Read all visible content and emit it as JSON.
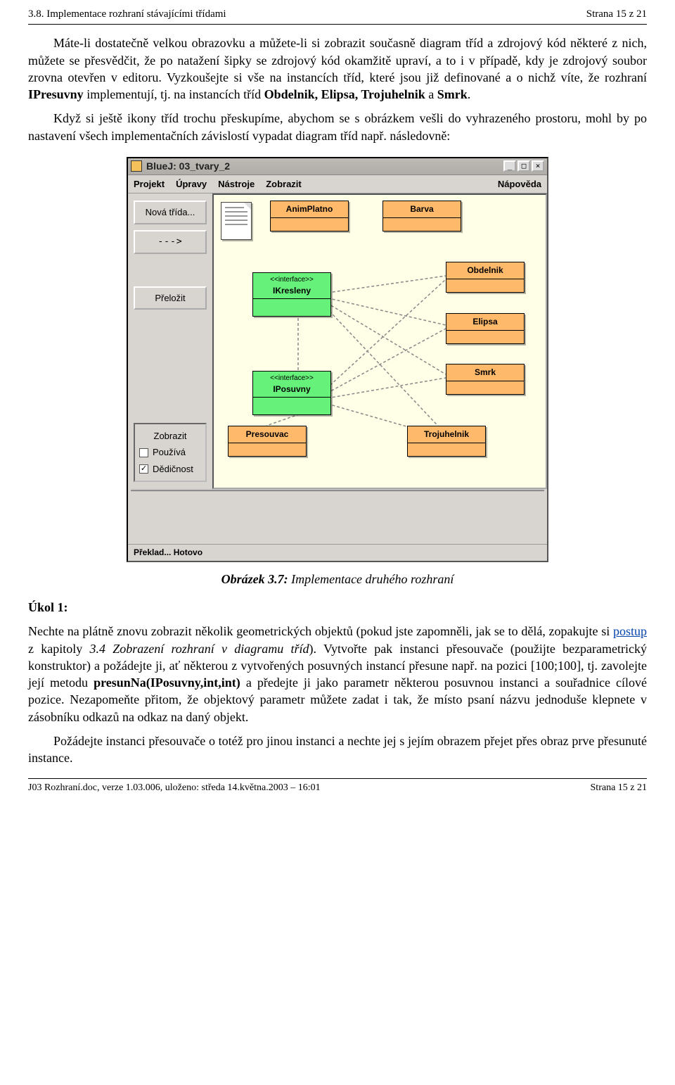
{
  "header": {
    "left": "3.8. Implementace rozhraní stávajícími třídami",
    "right": "Strana 15 z 21"
  },
  "para1_a": "Máte-li dostatečně velkou obrazovku a můžete-li si zobrazit současně diagram tříd a zdrojový kód některé z nich, můžete se přesvědčit, že po natažení šipky se zdrojový kód okamžitě upraví, a to i v případě, kdy je zdrojový soubor zrovna otevřen v editoru. Vyzkoušejte si vše na instancích tříd, které jsou již definované a o nichž víte, že rozhraní ",
  "para1_b": "IPresuvny",
  "para1_c": " implementují, tj. na instancích tříd ",
  "para1_d": "Obdelnik, Elipsa, Trojuhelnik",
  "para1_e": " a ",
  "para1_f": "Smrk",
  "para1_g": ".",
  "para2": "Když si ještě ikony tříd trochu přeskupíme, abychom se s obrázkem vešli do vyhrazeného prostoru, mohl by po nastavení všech implementačních závislostí vypadat diagram tříd např. následovně:",
  "win": {
    "title": "BlueJ:  03_tvary_2",
    "menu": {
      "items": [
        "Projekt",
        "Úpravy",
        "Nástroje",
        "Zobrazit"
      ],
      "right": "Nápověda"
    },
    "sidebar": {
      "new_class": "Nová třída...",
      "arrow": "--->",
      "compile": "Přeložit",
      "view_title": "Zobrazit",
      "uses": "Používá",
      "inherits": "Dědičnost"
    },
    "classes": {
      "animplatno": "AnimPlatno",
      "barva": "Barva",
      "ikresleny_stereo": "<<interface>>",
      "ikresleny": "IKresleny",
      "iposuvny_stereo": "<<interface>>",
      "iposuvny": "IPosuvny",
      "obdelnik": "Obdelnik",
      "elipsa": "Elipsa",
      "smrk": "Smrk",
      "presouvac": "Presouvac",
      "trojuhelnik": "Trojuhelnik"
    },
    "status": "Překlad... Hotovo"
  },
  "caption_bold": "Obrázek 3.7:",
  "caption_rest": "   Implementace druhého rozhraní",
  "task_heading": "Úkol 1:",
  "task_a": "Nechte na plátně znovu zobrazit několik geometrických objektů (pokud jste zapomněli, jak se to dělá, zopakujte si ",
  "task_link": "postup",
  "task_b": " z kapitoly ",
  "task_c": "3.4 Zobrazení rozhraní v diagramu tříd",
  "task_d": "). Vytvořte pak instanci přesouvače (použijte bezparametrický konstruktor) a požádejte ji, ať některou z vytvořených posuvných instancí přesune např. na pozici [100;100], tj. zavolejte její metodu ",
  "task_e": "presunNa(IPosuvny,int,int)",
  "task_f": " a předejte ji jako parametr některou posuvnou instanci a souřadnice cílové pozice. Nezapomeňte přitom, že objektový parametr můžete zadat i tak, že místo psaní názvu jednoduše klepnete v zásobníku odkazů na odkaz na daný objekt.",
  "task_para2": "Požádejte instanci přesouvače o totéž pro jinou instanci a nechte jej s jejím obrazem přejet přes obraz prve přesunuté instance.",
  "footer": {
    "left": "J03 Rozhraní.doc, verze 1.03.006, uloženo: středa 14.května.2003 – 16:01",
    "right": "Strana 15 z 21"
  }
}
